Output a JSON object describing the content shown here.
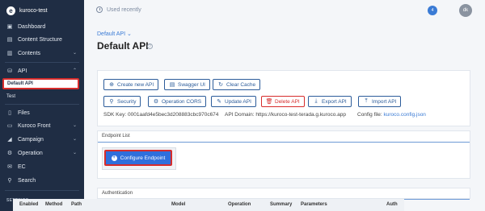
{
  "sidebar": {
    "project": "kuroco-test",
    "items": [
      {
        "label": "Dashboard",
        "icon": "dashboard-icon"
      },
      {
        "label": "Content Structure",
        "icon": "content-structure-icon"
      },
      {
        "label": "Contents",
        "icon": "contents-icon"
      },
      {
        "label": "API",
        "icon": "api-icon"
      },
      {
        "label": "Files",
        "icon": "files-icon"
      },
      {
        "label": "Kuroco Front",
        "icon": "kuroco-front-icon"
      },
      {
        "label": "Campaign",
        "icon": "campaign-icon"
      },
      {
        "label": "Operation",
        "icon": "operation-icon"
      },
      {
        "label": "EC",
        "icon": "ec-icon"
      },
      {
        "label": "Search",
        "icon": "search-icon"
      }
    ],
    "api_sub": {
      "active": "Default API",
      "other": "Test"
    },
    "settings_label": "SETTINGS"
  },
  "topbar": {
    "recent_label": "Used recently",
    "notification_count": "4",
    "avatar_initials": "dk"
  },
  "main": {
    "breadcrumb": "Default API",
    "title": "Default API",
    "buttons_row1": [
      "Create new API",
      "Swagger UI",
      "Clear Cache"
    ],
    "buttons_row2": [
      "Security",
      "Operation CORS",
      "Update API",
      "Delete API",
      "Export API",
      "Import API"
    ],
    "sdk_key_label": "SDK Key:",
    "sdk_key": "0001aafd4e5bec3d208883cbc970c674",
    "api_domain_label": "API Domain:",
    "api_domain": "https://kuroco-test-terada.g.kuroco.app",
    "config_label": "Config file:",
    "config_file": "kuroco.config.json",
    "endpoint_list_label": "Endpoint List",
    "configure_endpoint_label": "Configure Endpoint",
    "authentication_label": "Authentication",
    "table_headers": [
      "Enabled",
      "Method",
      "Path",
      "Model",
      "Operation",
      "Summary",
      "Parameters",
      "Auth"
    ]
  }
}
